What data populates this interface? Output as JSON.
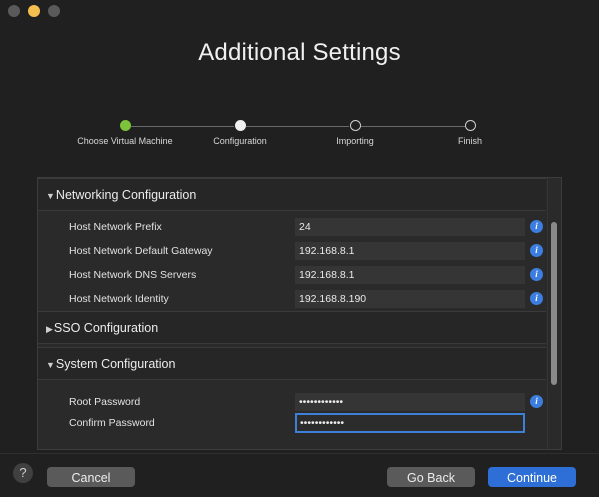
{
  "window": {
    "title": "Additional Settings"
  },
  "steps": [
    {
      "label": "Choose Virtual Machine",
      "state": "done"
    },
    {
      "label": "Configuration",
      "state": "current"
    },
    {
      "label": "Importing",
      "state": "pending"
    },
    {
      "label": "Finish",
      "state": "pending"
    }
  ],
  "sections": {
    "networking": {
      "title": "Networking Configuration",
      "expanded": true,
      "rows": [
        {
          "label": "Host Network Prefix",
          "value": "24"
        },
        {
          "label": "Host Network Default Gateway",
          "value": "192.168.8.1"
        },
        {
          "label": "Host Network DNS Servers",
          "value": "192.168.8.1"
        },
        {
          "label": "Host Network Identity",
          "value": "192.168.8.190"
        }
      ]
    },
    "sso": {
      "title": "SSO Configuration",
      "expanded": false
    },
    "system": {
      "title": "System Configuration",
      "expanded": true,
      "rows": [
        {
          "label": "Root Password",
          "value": "••••••••••••"
        },
        {
          "label": "Confirm Password",
          "value": "••••••••••••"
        }
      ]
    }
  },
  "icons": {
    "info": "info-icon",
    "help": "question-mark-icon",
    "expanded": "triangle-down-icon",
    "collapsed": "triangle-right-icon"
  },
  "colors": {
    "accent": "#2d6fd6",
    "step_done": "#7cc23a",
    "info": "#3b7ee0"
  },
  "footer": {
    "help_label": "?",
    "cancel_label": "Cancel",
    "back_label": "Go Back",
    "continue_label": "Continue"
  }
}
